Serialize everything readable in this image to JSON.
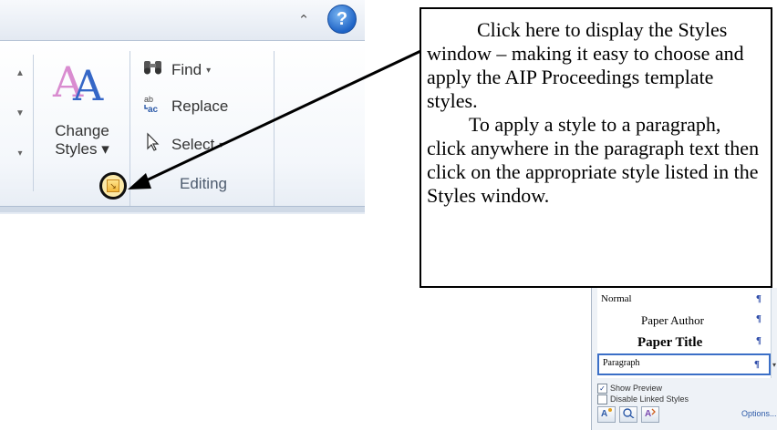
{
  "ribbon": {
    "help_glyph": "?",
    "collapse_glyph": "⌃",
    "change_styles": {
      "icon_glyph": "A",
      "label_line1": "Change",
      "label_line2": "Styles ▾"
    },
    "editing": {
      "find_label": "Find",
      "replace_label": "Replace",
      "select_label": "Select",
      "group_label": "Editing",
      "dropdown_glyph": "▾"
    },
    "dialog_launcher_glyph": "↘",
    "gallery_arrows": [
      "▲",
      "▼",
      "▾"
    ]
  },
  "callout": {
    "paragraph1": "Click here to display the Styles window – making it easy to choose and apply the AIP Proceedings template styles.",
    "paragraph2": "To apply a style to a paragraph, click anywhere in the paragraph text then click on the appropriate style listed in the Styles window."
  },
  "styles_pane": {
    "items": [
      {
        "name": "Normal",
        "mark": "¶"
      },
      {
        "name": "Paper Author",
        "mark": "¶"
      },
      {
        "name": "Paper Title",
        "mark": "¶"
      },
      {
        "name": "Paragraph",
        "mark": "¶"
      }
    ],
    "show_preview_label": "Show Preview",
    "show_preview_checked": true,
    "disable_linked_label": "Disable Linked Styles",
    "disable_linked_checked": false,
    "options_label": "Options..."
  },
  "colors": {
    "accent_blue": "#2c5aa8",
    "highlight_yellow": "#fbe9a8"
  },
  "icons": [
    "collapse-ribbon-icon",
    "help-icon",
    "change-styles-icon",
    "binoculars-icon",
    "replace-icon",
    "select-cursor-icon",
    "dialog-launcher-icon",
    "new-style-icon",
    "style-inspector-icon",
    "manage-styles-icon"
  ]
}
